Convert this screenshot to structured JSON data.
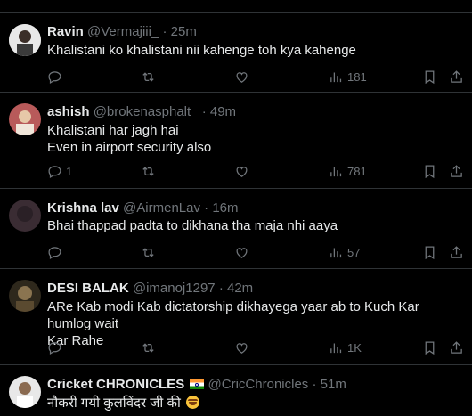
{
  "tweets": [
    {
      "name": "Ravin",
      "handle": "@Vermajiii_",
      "time": "25m",
      "lines": [
        "Khalistani ko khalistani nii kahenge toh kya kahenge"
      ],
      "replies": "",
      "retweets": "",
      "likes": "",
      "views": "181",
      "avatar_colors": [
        "#d8d8d8",
        "#3a3a3a"
      ]
    },
    {
      "name": "ashish",
      "handle": "@brokenasphalt_",
      "time": "49m",
      "lines": [
        "Khalistani har jagh hai",
        "Even in airport security also"
      ],
      "replies": "1",
      "retweets": "",
      "likes": "",
      "views": "781",
      "avatar_colors": [
        "#a44b4b",
        "#e0d0c0"
      ]
    },
    {
      "name": "Krishna lav",
      "handle": "@AirmenLav",
      "time": "16m",
      "lines": [
        "Bhai thappad padta to dikhana tha maja nhi aaya"
      ],
      "replies": "",
      "retweets": "",
      "likes": "",
      "views": "57",
      "avatar_colors": [
        "#3a2c33",
        "#2a2026"
      ]
    },
    {
      "name": "DESI BALAK",
      "handle": "@imanoj1297",
      "time": "42m",
      "lines": [
        "ARe Kab modi Kab dictatorship dikhayega yaar ab to Kuch Kar humlog wait",
        "Kar Rahe"
      ],
      "replies": "",
      "retweets": "",
      "likes": "",
      "views": "1K",
      "avatar_colors": [
        "#6b5a3a",
        "#2e281c"
      ]
    },
    {
      "name": "Cricket CHRONICLES",
      "handle": "@CricChronicles",
      "time": "51m",
      "lines": [
        "नौकरी गयी कुलविंदर जी की"
      ],
      "replies": "",
      "retweets": "",
      "likes": "",
      "views": "",
      "avatar_colors": [
        "#e8e8e8",
        "#7a6a5a"
      ]
    }
  ],
  "icons": {
    "reply": "reply-icon",
    "retweet": "retweet-icon",
    "like": "like-icon",
    "views": "views-icon",
    "bookmark": "bookmark-icon",
    "share": "share-icon",
    "flag": "india-flag-icon",
    "emoji": "laughing-emoji-icon"
  },
  "colors": {
    "background": "#000000",
    "text": "#e7e9ea",
    "secondary": "#71767b",
    "divider": "#2f3336"
  }
}
